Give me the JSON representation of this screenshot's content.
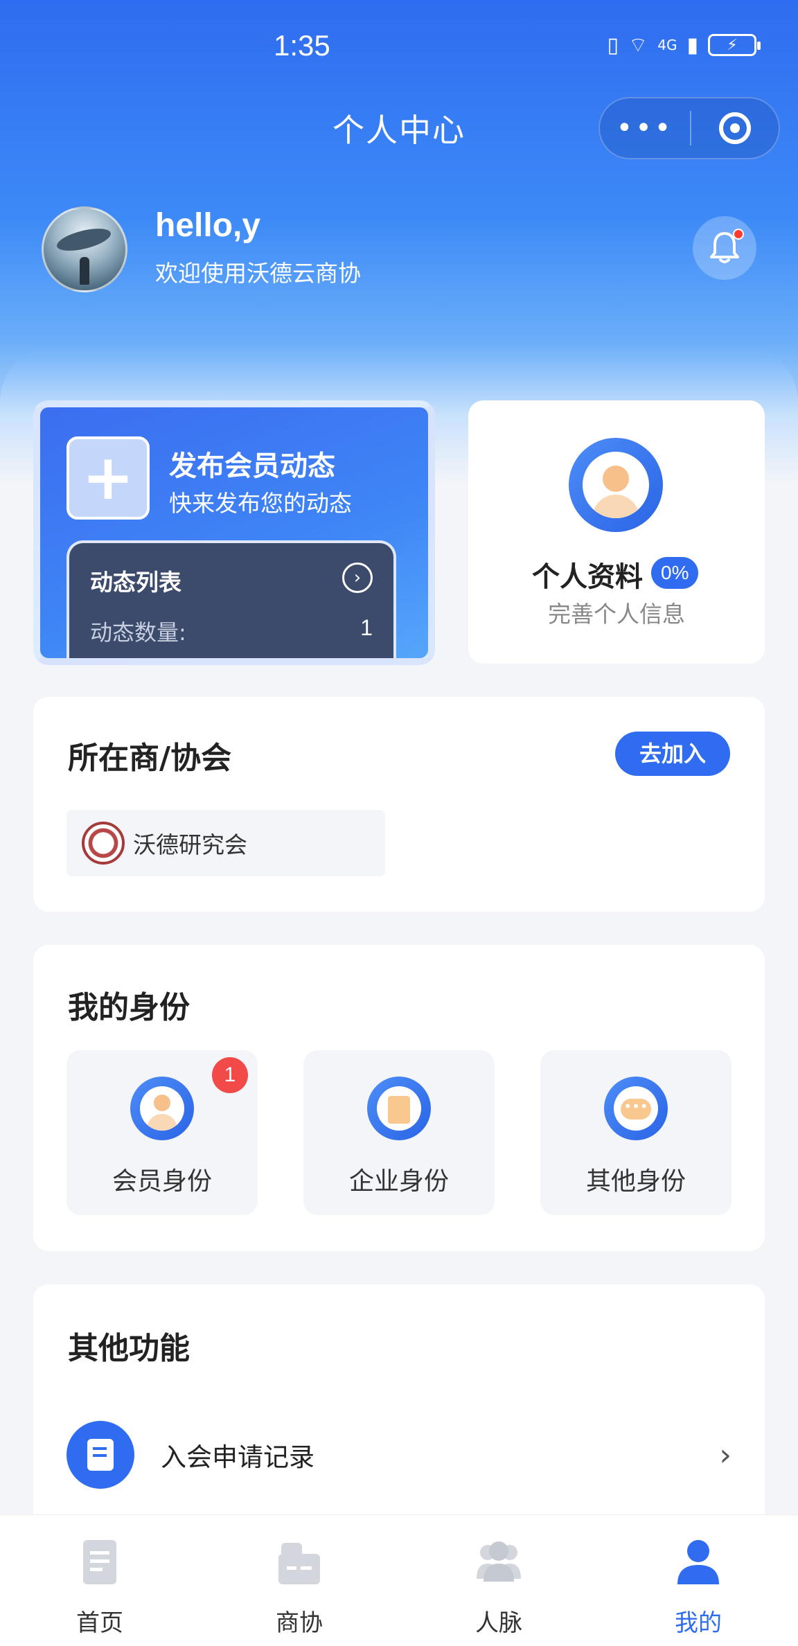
{
  "status_bar": {
    "time": "1:35",
    "network": "4G",
    "battery_icon": "battery-charging-icon"
  },
  "nav": {
    "title": "个人中心",
    "more_icon": "more-dots-icon",
    "close_icon": "target-circle-icon"
  },
  "user": {
    "greeting": "hello,y",
    "welcome": "欢迎使用沃德云商协",
    "avatar_icon": "avatar-image",
    "notification_icon": "bell-icon"
  },
  "post_card": {
    "title": "发布会员动态",
    "subtitle": "快来发布您的动态",
    "list_title": "动态列表",
    "count_label": "动态数量:",
    "count_value": "1"
  },
  "profile_card": {
    "title": "个人资料",
    "progress": "0%",
    "subtitle": "完善个人信息"
  },
  "association": {
    "title": "所在商/协会",
    "join_label": "去加入",
    "items": [
      {
        "name": "沃德研究会"
      }
    ]
  },
  "identity": {
    "title": "我的身份",
    "items": [
      {
        "label": "会员身份",
        "badge": "1",
        "icon": "member-icon"
      },
      {
        "label": "企业身份",
        "icon": "enterprise-icon"
      },
      {
        "label": "其他身份",
        "icon": "other-identity-icon"
      }
    ]
  },
  "other_functions": {
    "title": "其他功能",
    "items": [
      {
        "label": "入会申请记录",
        "icon": "application-record-icon"
      }
    ]
  },
  "tabbar": {
    "items": [
      {
        "label": "首页",
        "icon": "home-icon"
      },
      {
        "label": "商协",
        "icon": "association-icon"
      },
      {
        "label": "人脉",
        "icon": "contacts-icon"
      },
      {
        "label": "我的",
        "icon": "profile-icon",
        "active": true
      }
    ]
  },
  "colors": {
    "primary": "#2f6cf0",
    "badge_red": "#f24949",
    "page_bg": "#f4f5f9"
  }
}
